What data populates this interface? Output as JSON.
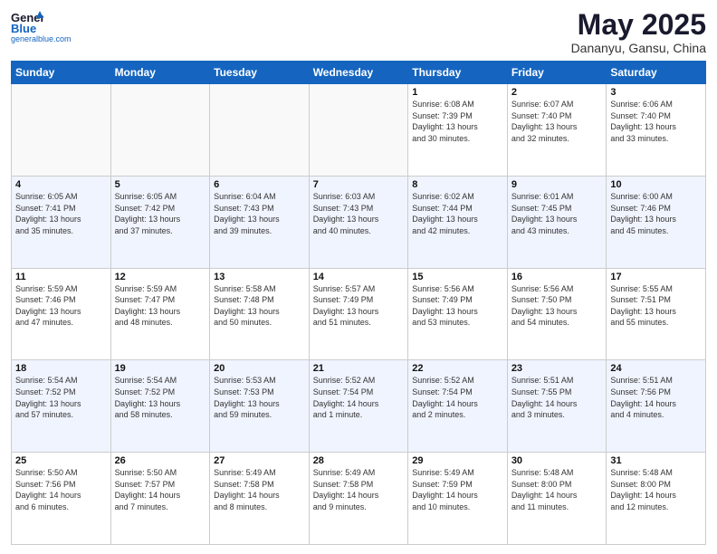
{
  "header": {
    "logo_general": "General",
    "logo_blue": "Blue",
    "logo_sub": "generalblue.com",
    "month_title": "May 2025",
    "location": "Dananyu, Gansu, China"
  },
  "days_of_week": [
    "Sunday",
    "Monday",
    "Tuesday",
    "Wednesday",
    "Thursday",
    "Friday",
    "Saturday"
  ],
  "weeks": [
    [
      {
        "day": "",
        "info": ""
      },
      {
        "day": "",
        "info": ""
      },
      {
        "day": "",
        "info": ""
      },
      {
        "day": "",
        "info": ""
      },
      {
        "day": "1",
        "info": "Sunrise: 6:08 AM\nSunset: 7:39 PM\nDaylight: 13 hours\nand 30 minutes."
      },
      {
        "day": "2",
        "info": "Sunrise: 6:07 AM\nSunset: 7:40 PM\nDaylight: 13 hours\nand 32 minutes."
      },
      {
        "day": "3",
        "info": "Sunrise: 6:06 AM\nSunset: 7:40 PM\nDaylight: 13 hours\nand 33 minutes."
      }
    ],
    [
      {
        "day": "4",
        "info": "Sunrise: 6:05 AM\nSunset: 7:41 PM\nDaylight: 13 hours\nand 35 minutes."
      },
      {
        "day": "5",
        "info": "Sunrise: 6:05 AM\nSunset: 7:42 PM\nDaylight: 13 hours\nand 37 minutes."
      },
      {
        "day": "6",
        "info": "Sunrise: 6:04 AM\nSunset: 7:43 PM\nDaylight: 13 hours\nand 39 minutes."
      },
      {
        "day": "7",
        "info": "Sunrise: 6:03 AM\nSunset: 7:43 PM\nDaylight: 13 hours\nand 40 minutes."
      },
      {
        "day": "8",
        "info": "Sunrise: 6:02 AM\nSunset: 7:44 PM\nDaylight: 13 hours\nand 42 minutes."
      },
      {
        "day": "9",
        "info": "Sunrise: 6:01 AM\nSunset: 7:45 PM\nDaylight: 13 hours\nand 43 minutes."
      },
      {
        "day": "10",
        "info": "Sunrise: 6:00 AM\nSunset: 7:46 PM\nDaylight: 13 hours\nand 45 minutes."
      }
    ],
    [
      {
        "day": "11",
        "info": "Sunrise: 5:59 AM\nSunset: 7:46 PM\nDaylight: 13 hours\nand 47 minutes."
      },
      {
        "day": "12",
        "info": "Sunrise: 5:59 AM\nSunset: 7:47 PM\nDaylight: 13 hours\nand 48 minutes."
      },
      {
        "day": "13",
        "info": "Sunrise: 5:58 AM\nSunset: 7:48 PM\nDaylight: 13 hours\nand 50 minutes."
      },
      {
        "day": "14",
        "info": "Sunrise: 5:57 AM\nSunset: 7:49 PM\nDaylight: 13 hours\nand 51 minutes."
      },
      {
        "day": "15",
        "info": "Sunrise: 5:56 AM\nSunset: 7:49 PM\nDaylight: 13 hours\nand 53 minutes."
      },
      {
        "day": "16",
        "info": "Sunrise: 5:56 AM\nSunset: 7:50 PM\nDaylight: 13 hours\nand 54 minutes."
      },
      {
        "day": "17",
        "info": "Sunrise: 5:55 AM\nSunset: 7:51 PM\nDaylight: 13 hours\nand 55 minutes."
      }
    ],
    [
      {
        "day": "18",
        "info": "Sunrise: 5:54 AM\nSunset: 7:52 PM\nDaylight: 13 hours\nand 57 minutes."
      },
      {
        "day": "19",
        "info": "Sunrise: 5:54 AM\nSunset: 7:52 PM\nDaylight: 13 hours\nand 58 minutes."
      },
      {
        "day": "20",
        "info": "Sunrise: 5:53 AM\nSunset: 7:53 PM\nDaylight: 13 hours\nand 59 minutes."
      },
      {
        "day": "21",
        "info": "Sunrise: 5:52 AM\nSunset: 7:54 PM\nDaylight: 14 hours\nand 1 minute."
      },
      {
        "day": "22",
        "info": "Sunrise: 5:52 AM\nSunset: 7:54 PM\nDaylight: 14 hours\nand 2 minutes."
      },
      {
        "day": "23",
        "info": "Sunrise: 5:51 AM\nSunset: 7:55 PM\nDaylight: 14 hours\nand 3 minutes."
      },
      {
        "day": "24",
        "info": "Sunrise: 5:51 AM\nSunset: 7:56 PM\nDaylight: 14 hours\nand 4 minutes."
      }
    ],
    [
      {
        "day": "25",
        "info": "Sunrise: 5:50 AM\nSunset: 7:56 PM\nDaylight: 14 hours\nand 6 minutes."
      },
      {
        "day": "26",
        "info": "Sunrise: 5:50 AM\nSunset: 7:57 PM\nDaylight: 14 hours\nand 7 minutes."
      },
      {
        "day": "27",
        "info": "Sunrise: 5:49 AM\nSunset: 7:58 PM\nDaylight: 14 hours\nand 8 minutes."
      },
      {
        "day": "28",
        "info": "Sunrise: 5:49 AM\nSunset: 7:58 PM\nDaylight: 14 hours\nand 9 minutes."
      },
      {
        "day": "29",
        "info": "Sunrise: 5:49 AM\nSunset: 7:59 PM\nDaylight: 14 hours\nand 10 minutes."
      },
      {
        "day": "30",
        "info": "Sunrise: 5:48 AM\nSunset: 8:00 PM\nDaylight: 14 hours\nand 11 minutes."
      },
      {
        "day": "31",
        "info": "Sunrise: 5:48 AM\nSunset: 8:00 PM\nDaylight: 14 hours\nand 12 minutes."
      }
    ]
  ]
}
